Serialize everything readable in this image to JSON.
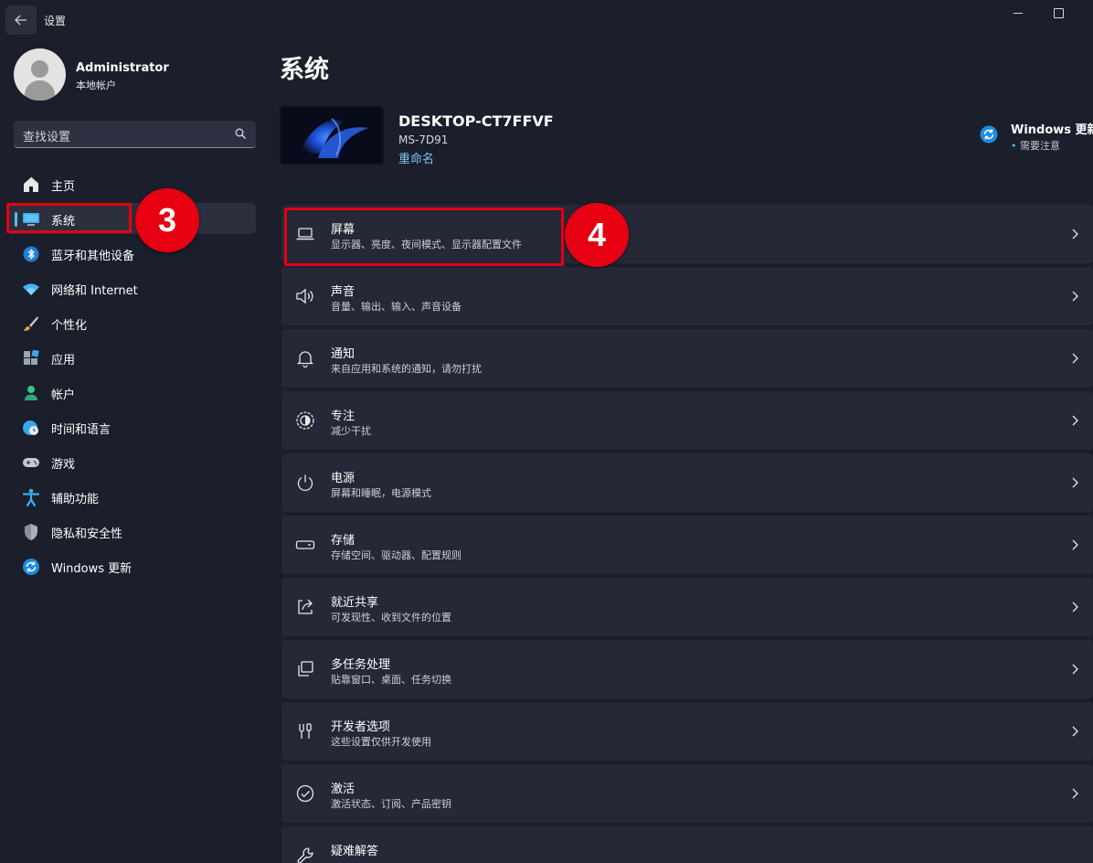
{
  "window": {
    "title": "设置"
  },
  "user": {
    "name": "Administrator",
    "account_type": "本地帐户"
  },
  "search": {
    "placeholder": "查找设置"
  },
  "sidebar": {
    "items": [
      {
        "label": "主页",
        "icon": "home-icon"
      },
      {
        "label": "系统",
        "icon": "monitor-icon",
        "selected": true
      },
      {
        "label": "蓝牙和其他设备",
        "icon": "bluetooth-icon"
      },
      {
        "label": "网络和 Internet",
        "icon": "wifi-icon"
      },
      {
        "label": "个性化",
        "icon": "brush-icon"
      },
      {
        "label": "应用",
        "icon": "apps-icon"
      },
      {
        "label": "帐户",
        "icon": "person-icon"
      },
      {
        "label": "时间和语言",
        "icon": "globe-clock-icon"
      },
      {
        "label": "游戏",
        "icon": "gamepad-icon"
      },
      {
        "label": "辅助功能",
        "icon": "accessibility-icon"
      },
      {
        "label": "隐私和安全性",
        "icon": "shield-icon"
      },
      {
        "label": "Windows 更新",
        "icon": "sync-icon"
      }
    ]
  },
  "main": {
    "title": "系统",
    "device": {
      "name": "DESKTOP-CT7FFVF",
      "model": "MS-7D91",
      "rename_link": "重命名"
    },
    "windows_update": {
      "title": "Windows 更新",
      "status": "需要注意"
    },
    "settings": [
      {
        "title": "屏幕",
        "subtitle": "显示器、亮度、夜间模式、显示器配置文件",
        "icon": "laptop-icon"
      },
      {
        "title": "声音",
        "subtitle": "音量、输出、输入、声音设备",
        "icon": "speaker-icon"
      },
      {
        "title": "通知",
        "subtitle": "来自应用和系统的通知，请勿打扰",
        "icon": "bell-icon"
      },
      {
        "title": "专注",
        "subtitle": "减少干扰",
        "icon": "focus-icon"
      },
      {
        "title": "电源",
        "subtitle": "屏幕和睡眠，电源模式",
        "icon": "power-icon"
      },
      {
        "title": "存储",
        "subtitle": "存储空间、驱动器、配置规则",
        "icon": "storage-icon"
      },
      {
        "title": "就近共享",
        "subtitle": "可发现性、收到文件的位置",
        "icon": "share-icon"
      },
      {
        "title": "多任务处理",
        "subtitle": "贴靠窗口、桌面、任务切换",
        "icon": "multitask-icon"
      },
      {
        "title": "开发者选项",
        "subtitle": "这些设置仅供开发使用",
        "icon": "developer-icon"
      },
      {
        "title": "激活",
        "subtitle": "激活状态、订阅、产品密钥",
        "icon": "check-circle-icon"
      },
      {
        "title": "疑难解答",
        "subtitle": "",
        "icon": "wrench-icon"
      }
    ]
  },
  "annotations": {
    "step_system": "3",
    "step_display": "4",
    "highlight_color": "#e60012"
  },
  "colors": {
    "background": "#1b1e2b",
    "card": "#252837",
    "accent": "#4cc2ff"
  }
}
